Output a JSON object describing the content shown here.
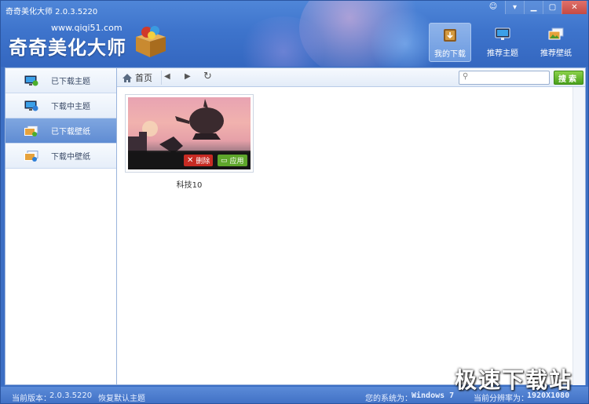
{
  "window": {
    "title": "奇奇美化大师 2.0.3.5220",
    "controls": [
      "skin-icon",
      "menu",
      "minimize",
      "maximize",
      "close"
    ]
  },
  "brand": {
    "url": "www.qiqi51.com",
    "logo": "奇奇美化大师"
  },
  "topnav": [
    {
      "label": "我的下载",
      "icon": "download-box-icon",
      "active": true
    },
    {
      "label": "推荐主题",
      "icon": "monitor-icon",
      "active": false
    },
    {
      "label": "推荐壁纸",
      "icon": "wallpaper-icon",
      "active": false
    }
  ],
  "sidebar": {
    "items": [
      {
        "label": "已下载主题",
        "icon": "monitor-check-icon",
        "active": false
      },
      {
        "label": "下载中主题",
        "icon": "monitor-download-icon",
        "active": false
      },
      {
        "label": "已下载壁纸",
        "icon": "wallpaper-check-icon",
        "active": true
      },
      {
        "label": "下载中壁纸",
        "icon": "wallpaper-download-icon",
        "active": false
      }
    ]
  },
  "toolbar": {
    "home_label": "首页",
    "search_placeholder": "",
    "search_value": "",
    "search_button": "搜索"
  },
  "wallpapers": [
    {
      "name": "科技10",
      "delete_label": "删除",
      "apply_label": "应用"
    }
  ],
  "status": {
    "version_label": "当前版本：",
    "version_value": "2.0.3.5220",
    "restore_label": "恢复默认主题",
    "os_label": "您的系统为：",
    "os_value": "Windows 7",
    "resolution_label": "当前分辨率为：",
    "resolution_value": "1920X1080"
  },
  "watermark": "极速下载站",
  "colors": {
    "header": "#3e74cc",
    "accent_active": "#6c9ae0",
    "delete": "#c72b23",
    "apply": "#5ea62b",
    "search_button": "#4aa01c"
  }
}
